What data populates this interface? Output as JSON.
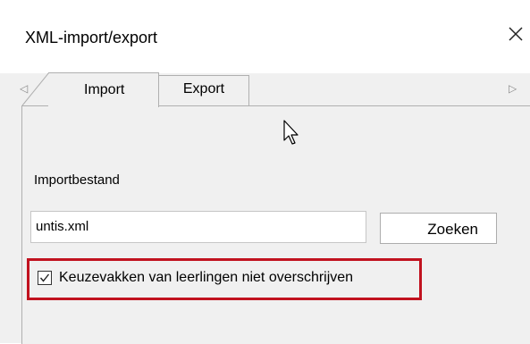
{
  "window": {
    "title": "XML-import/export"
  },
  "tabs": [
    {
      "label": "Import",
      "selected": true
    },
    {
      "label": "Export",
      "selected": false
    }
  ],
  "import": {
    "file_label": "Importbestand",
    "file_value": "untis.xml",
    "search_button": "Zoeken",
    "checkbox_label": "Keuzevakken van leerlingen niet overschrijven",
    "checkbox_checked": true
  },
  "icons": {
    "close": "close-icon",
    "tab_left": "triangle-left-icon",
    "tab_right": "triangle-right-icon",
    "cursor": "mouse-pointer-icon"
  },
  "colors": {
    "highlight": "#c1121f",
    "background": "#f0f0f0"
  }
}
